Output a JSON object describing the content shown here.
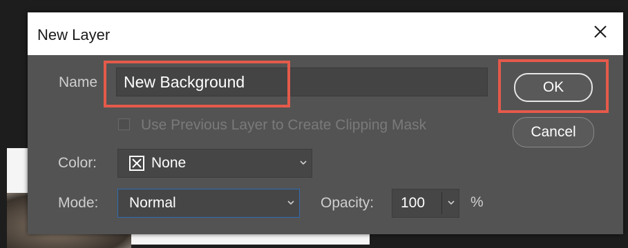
{
  "dialog": {
    "title": "New Layer",
    "name_label": "Name",
    "name_value": "New Background",
    "ok_label": "OK",
    "cancel_label": "Cancel",
    "clipping_mask_label": "Use Previous Layer to Create Clipping Mask",
    "clipping_mask_checked": false,
    "color_label": "Color:",
    "color_value": "None",
    "mode_label": "Mode:",
    "mode_value": "Normal",
    "opacity_label": "Opacity:",
    "opacity_value": "100",
    "opacity_unit": "%"
  },
  "icons": {
    "close": "close-icon",
    "dropdown": "chevron-down-icon",
    "color_swatch": "x-box-icon"
  },
  "colors": {
    "dialog_bg": "#535353",
    "titlebar_bg": "#ffffff",
    "highlight": "#e55a4a",
    "focus_border": "#2e6cb3"
  }
}
